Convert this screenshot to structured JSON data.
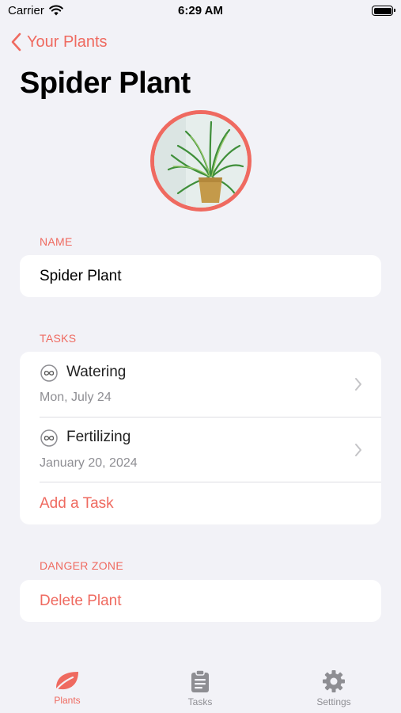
{
  "status_bar": {
    "carrier": "Carrier",
    "time": "6:29 AM"
  },
  "nav": {
    "back_label": "Your Plants"
  },
  "page": {
    "title": "Spider Plant"
  },
  "name_section": {
    "header": "NAME",
    "value": "Spider Plant"
  },
  "tasks_section": {
    "header": "TASKS",
    "items": [
      {
        "icon": "infinity-icon",
        "title": "Watering",
        "date": "Mon, July 24"
      },
      {
        "icon": "infinity-icon",
        "title": "Fertilizing",
        "date": "January 20, 2024"
      }
    ],
    "add_label": "Add a Task"
  },
  "danger_section": {
    "header": "DANGER ZONE",
    "delete_label": "Delete Plant"
  },
  "tab_bar": {
    "tabs": [
      {
        "label": "Plants",
        "icon": "leaf-icon",
        "active": true
      },
      {
        "label": "Tasks",
        "icon": "clipboard-icon",
        "active": false
      },
      {
        "label": "Settings",
        "icon": "gear-icon",
        "active": false
      }
    ]
  },
  "colors": {
    "accent": "#ef6a60",
    "background": "#f2f2f7",
    "secondary_text": "#8e8e93",
    "inactive_tab": "#8e8e93"
  }
}
